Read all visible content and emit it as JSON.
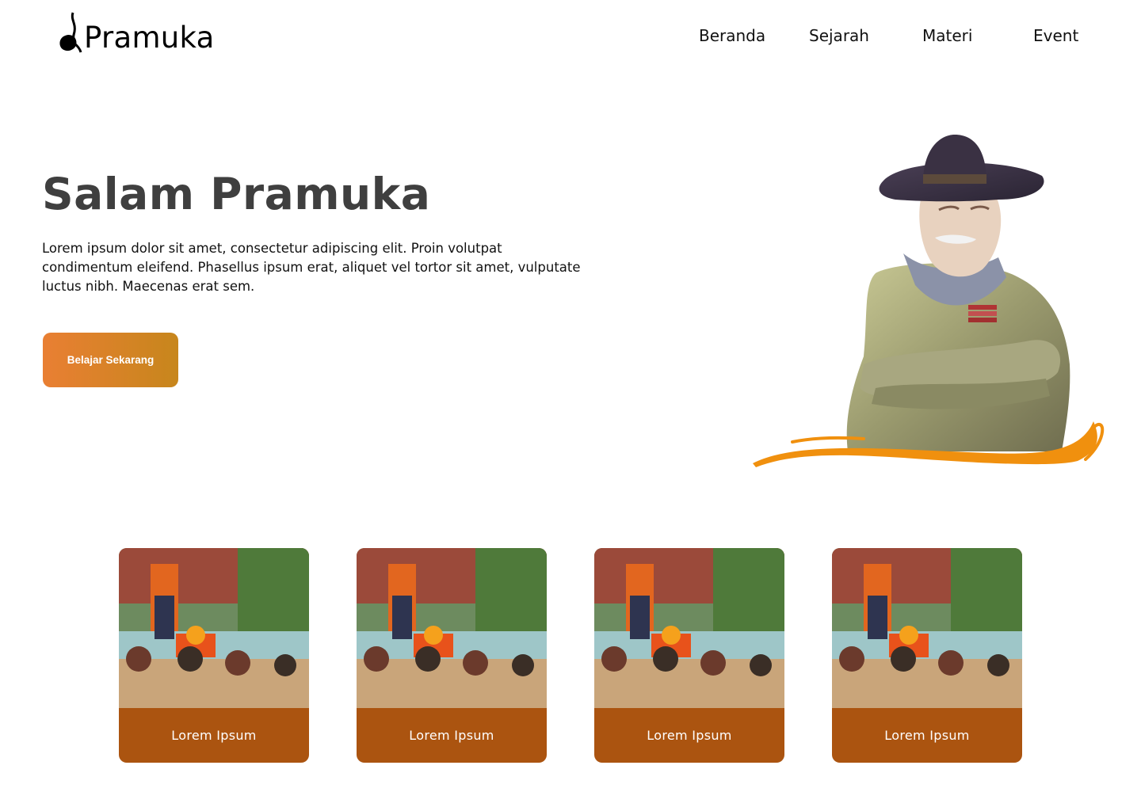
{
  "brand": {
    "name": "Pramuka",
    "icon": "tunas-kelapa-icon"
  },
  "nav": {
    "items": [
      "Beranda",
      "Sejarah",
      "Materi",
      "Event"
    ]
  },
  "hero": {
    "title": "Salam Pramuka",
    "description": "Lorem ipsum dolor sit amet, consectetur adipiscing elit. Proin volutpat condimentum eleifend. Phasellus ipsum erat, aliquet vel tortor sit amet, vulputate luctus nibh. Maecenas erat sem.",
    "cta_label": "Belajar Sekarang",
    "image": "scout-founder-portrait"
  },
  "cards": [
    {
      "label": "Lorem Ipsum",
      "image": "scout-activity-photo"
    },
    {
      "label": "Lorem Ipsum",
      "image": "scout-activity-photo"
    },
    {
      "label": "Lorem Ipsum",
      "image": "scout-activity-photo"
    },
    {
      "label": "Lorem Ipsum",
      "image": "scout-activity-photo"
    }
  ],
  "colors": {
    "accent_gradient_start": "#e97f33",
    "accent_gradient_end": "#c7861c",
    "card_label_bg": "#ab5410",
    "title_text": "#3f3f3f",
    "swoosh": "#f0900e"
  }
}
